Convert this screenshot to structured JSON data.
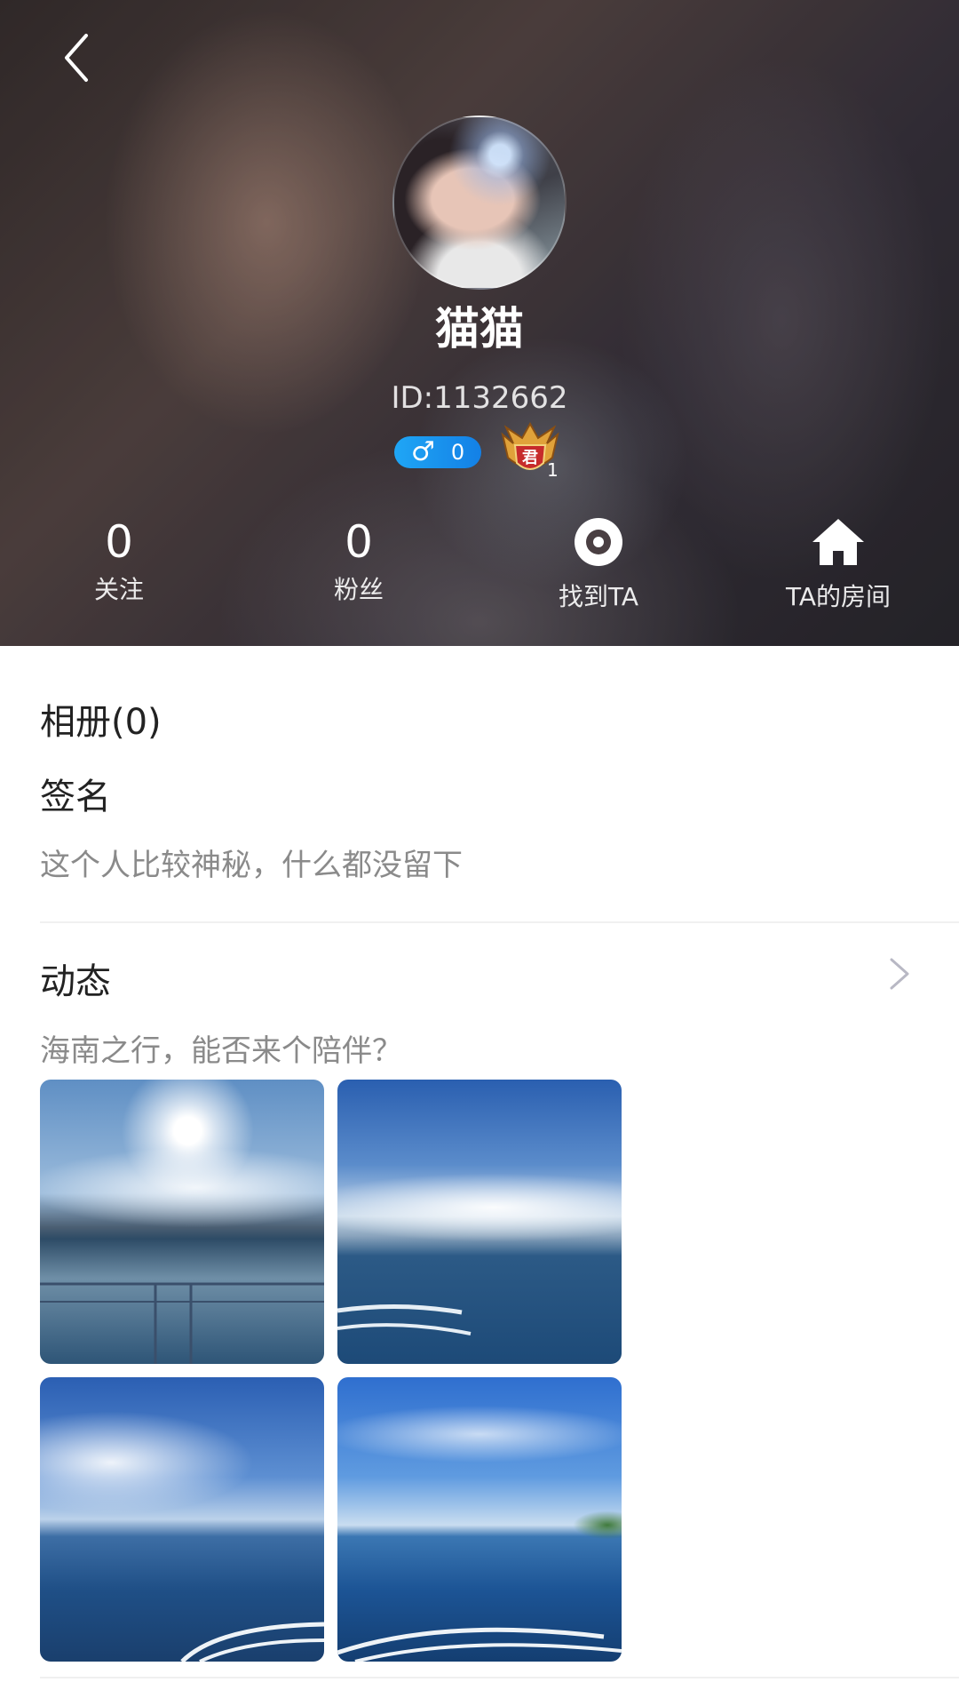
{
  "header": {
    "back_icon": "chevron-left-icon",
    "nickname": "猫猫",
    "user_id": "ID:1132662",
    "gender_symbol": "♂",
    "gender_color": "#1fa6f5",
    "gender_value": "0",
    "level_badge_icon": "crown-shield-icon",
    "level_badge_char": "君",
    "level_value": "1"
  },
  "stats": {
    "following_value": "0",
    "following_label": "关注",
    "fans_value": "0",
    "fans_label": "粉丝",
    "find_label": "找到TA",
    "find_icon": "target-icon",
    "room_label": "TA的房间",
    "room_icon": "home-icon"
  },
  "album": {
    "title": "相册(0)"
  },
  "signature": {
    "title": "签名",
    "text": "这个人比较神秘，什么都没留下"
  },
  "moments": {
    "title": "动态",
    "arrow_icon": "chevron-right-icon",
    "post_text": "海南之行，能否来个陪伴？",
    "photos": [
      "photo-1",
      "photo-2",
      "photo-3",
      "photo-4"
    ]
  }
}
